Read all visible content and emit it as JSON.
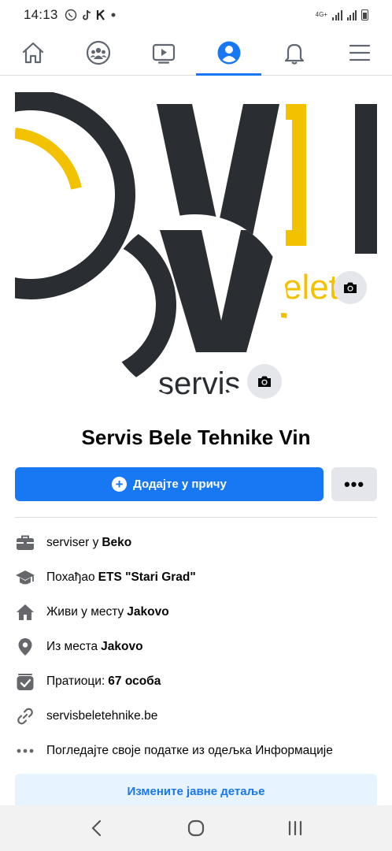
{
  "status_bar": {
    "time": "14:13",
    "network": "4G+",
    "icons": [
      "viber-icon",
      "tiktok-icon",
      "k-icon",
      "dot"
    ]
  },
  "top_nav": {
    "items": [
      {
        "icon": "home-icon"
      },
      {
        "icon": "groups-icon"
      },
      {
        "icon": "watch-icon"
      },
      {
        "icon": "profile-icon",
        "active": true
      },
      {
        "icon": "bell-icon"
      },
      {
        "icon": "menu-icon"
      }
    ]
  },
  "colors": {
    "accent": "#1877f2",
    "logo_dark": "#2a2d32",
    "logo_yellow": "#f2c200"
  },
  "cover": {
    "logo_letters": "V",
    "logo_text_fragment": "elete"
  },
  "avatar": {
    "logo_letter": "V",
    "logo_text": "servis"
  },
  "profile": {
    "name": "Servis Bele Tehnike Vin"
  },
  "actions": {
    "add_story_label": "Додајте у причу",
    "more_label": "•••"
  },
  "details": [
    {
      "icon": "briefcase-icon",
      "text": "serviser у",
      "bold": "Beko"
    },
    {
      "icon": "graduation-cap-icon",
      "text": "Похађао",
      "bold": "ETS \"Stari Grad\""
    },
    {
      "icon": "house-icon",
      "text": "Живи у месту",
      "bold": "Jakovo"
    },
    {
      "icon": "location-pin-icon",
      "text": "Из места",
      "bold": "Jakovo"
    },
    {
      "icon": "followers-icon",
      "text": "Пратиоци:",
      "bold": "67 особа"
    },
    {
      "icon": "link-icon",
      "text": "servisbeletehnike.be",
      "bold": ""
    },
    {
      "icon": "more-dots-icon",
      "text": "Погледајте своје податке из одељка Информације",
      "bold": ""
    }
  ],
  "edit_public_label": "Измените јавне детаље",
  "android_nav": [
    "back-icon",
    "home-circle-icon",
    "recents-icon"
  ]
}
